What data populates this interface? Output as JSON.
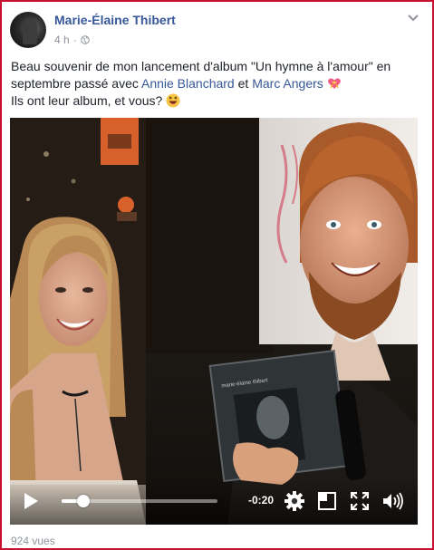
{
  "post": {
    "author": "Marie-Élaine Thibert",
    "time": "4 h",
    "text_part1": "Beau souvenir de mon lancement d'album \"Un hymne à l'amour\" en septembre passé avec ",
    "mention1": "Annie Blanchard",
    "text_and": " et ",
    "mention2": "Marc Angers",
    "text_line2": "Ils ont leur album, et vous?",
    "icons": {
      "more": "more-options-icon",
      "audience": "globe-icon",
      "emoji1": "heart-with-ribbon-emoji",
      "emoji2": "laughing-face-emoji"
    }
  },
  "video": {
    "time_remaining": "-0:20",
    "progress_fraction": 0.14,
    "controls": [
      "play-icon",
      "settings-gear-icon",
      "picture-in-picture-icon",
      "fullscreen-icon",
      "volume-icon"
    ],
    "cd_cover_text": "marie-élaine thibert"
  },
  "footer": {
    "views": "924 vues"
  },
  "colors": {
    "link": "#365899",
    "meta": "#90949c",
    "border": "#c8102e"
  }
}
